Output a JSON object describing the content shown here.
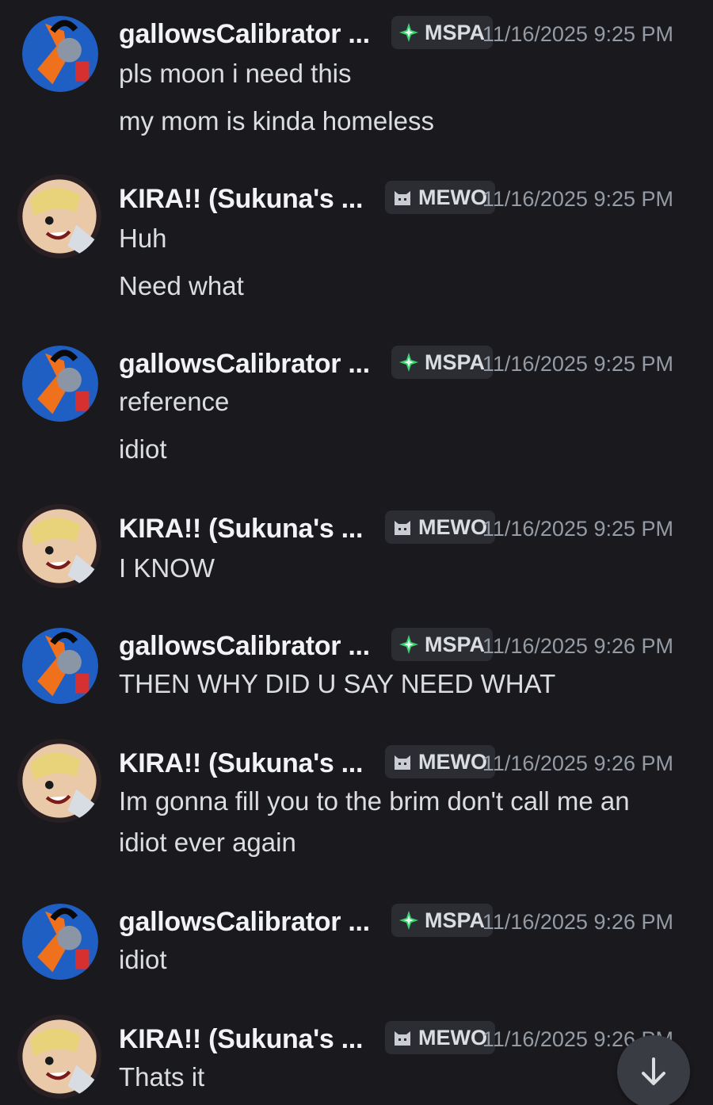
{
  "users": {
    "gallows": {
      "name": "gallowsCalibrator ...",
      "tag": "MSPA",
      "tag_icon": "sparkle-icon"
    },
    "kira": {
      "name": "KIRA!! (Sukuna's ...",
      "tag": "MEWO",
      "tag_icon": "cat-icon"
    }
  },
  "messages": [
    {
      "user": "gallowsCalibrator ...",
      "tag": "MSPA",
      "time": "11/16/2025 9:25 PM",
      "lines": [
        "pls moon i need this",
        "my mom is kinda homeless"
      ]
    },
    {
      "user": "KIRA!! (Sukuna's ...",
      "tag": "MEWO",
      "time": "11/16/2025 9:25 PM",
      "lines": [
        "Huh",
        "Need what"
      ]
    },
    {
      "user": "gallowsCalibrator ...",
      "tag": "MSPA",
      "time": "11/16/2025 9:25 PM",
      "lines": [
        "reference",
        "idiot"
      ]
    },
    {
      "user": "KIRA!! (Sukuna's ...",
      "tag": "MEWO",
      "time": "11/16/2025 9:25 PM",
      "lines": [
        "I KNOW"
      ]
    },
    {
      "user": "gallowsCalibrator ...",
      "tag": "MSPA",
      "time": "11/16/2025 9:26 PM",
      "lines": [
        "THEN WHY DID U SAY NEED WHAT"
      ]
    },
    {
      "user": "KIRA!! (Sukuna's ...",
      "tag": "MEWO",
      "time": "11/16/2025 9:26 PM",
      "lines": [
        "Im gonna fill you to the brim don't call me an",
        "idiot ever again"
      ]
    },
    {
      "user": "gallowsCalibrator ...",
      "tag": "MSPA",
      "time": "11/16/2025 9:26 PM",
      "lines": [
        "idiot"
      ]
    },
    {
      "user": "KIRA!! (Sukuna's ...",
      "tag": "MEWO",
      "time": "11/16/2025 9:26 PM",
      "lines": [
        "Thats it"
      ]
    }
  ],
  "jump_button_icon": "arrow-down-icon",
  "colors": {
    "background": "#1a1a1e",
    "username": "#f2f3f5",
    "text": "#dbdee1",
    "timestamp": "#949ba4",
    "tag_bg": "#2b2d33",
    "mspa_green": "#3bd16f"
  }
}
